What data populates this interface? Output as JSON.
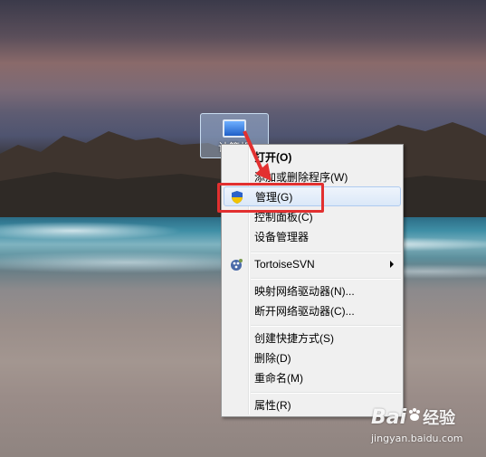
{
  "desktop_icon": {
    "label": "计算机"
  },
  "context_menu": {
    "items": [
      {
        "label": "打开(O)",
        "bold": true
      },
      {
        "label": "添加或删除程序(W)"
      },
      {
        "label": "管理(G)",
        "highlighted": true,
        "icon": "uac-shield-icon"
      },
      {
        "label": "控制面板(C)"
      },
      {
        "label": "设备管理器"
      },
      {
        "label": "TortoiseSVN",
        "icon": "tortoisesvn-icon",
        "submenu": true
      },
      {
        "label": "映射网络驱动器(N)..."
      },
      {
        "label": "断开网络驱动器(C)..."
      },
      {
        "label": "创建快捷方式(S)"
      },
      {
        "label": "删除(D)"
      },
      {
        "label": "重命名(M)"
      },
      {
        "label": "属性(R)"
      }
    ]
  },
  "annotation": {
    "color": "#e23030"
  },
  "watermark": {
    "brand": "Bai",
    "brand2": "经验",
    "site": "jingyan.baidu.com"
  }
}
